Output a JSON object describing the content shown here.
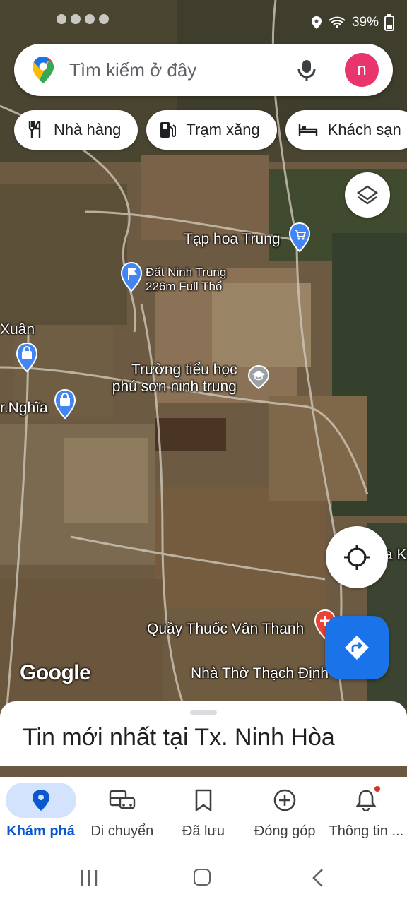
{
  "status_bar": {
    "battery": "39%"
  },
  "search": {
    "placeholder": "Tìm kiếm ở đây",
    "avatar_letter": "n"
  },
  "chips": [
    {
      "label": "Nhà hàng",
      "icon": "fork-knife-icon"
    },
    {
      "label": "Trạm xăng",
      "icon": "gas-station-icon"
    },
    {
      "label": "Khách sạn",
      "icon": "bed-icon"
    }
  ],
  "map": {
    "labels": {
      "tap_hoa": "Tạp hoa Trung",
      "dat_line1": "Đất Ninh Trung",
      "dat_line2": "226m Full Thổ",
      "xuan": "Xuân",
      "truong_line1": "Trường tiểu học",
      "truong_line2": "phú sơn ninh trung",
      "nghia": "r.Nghĩa",
      "quay_thuoc": "Quầy Thuốc Vân Thanh",
      "nha_tho": "Nhà Thờ Thạch Định",
      "edge_k": "a K"
    },
    "watermark": "Google"
  },
  "sheet": {
    "title": "Tin mới nhất tại Tx. Ninh Hòa"
  },
  "nav": [
    {
      "label": "Khám phá",
      "icon": "location-pin-icon",
      "active": true
    },
    {
      "label": "Di chuyển",
      "icon": "commute-icon",
      "active": false
    },
    {
      "label": "Đã lưu",
      "icon": "bookmark-icon",
      "active": false
    },
    {
      "label": "Đóng góp",
      "icon": "add-circle-icon",
      "active": false
    },
    {
      "label": "Thông tin ...",
      "icon": "bell-icon",
      "active": false
    }
  ],
  "colors": {
    "accent": "#1a73e8",
    "avatar": "#e8356d",
    "active_nav_bg": "#d3e3fd"
  }
}
